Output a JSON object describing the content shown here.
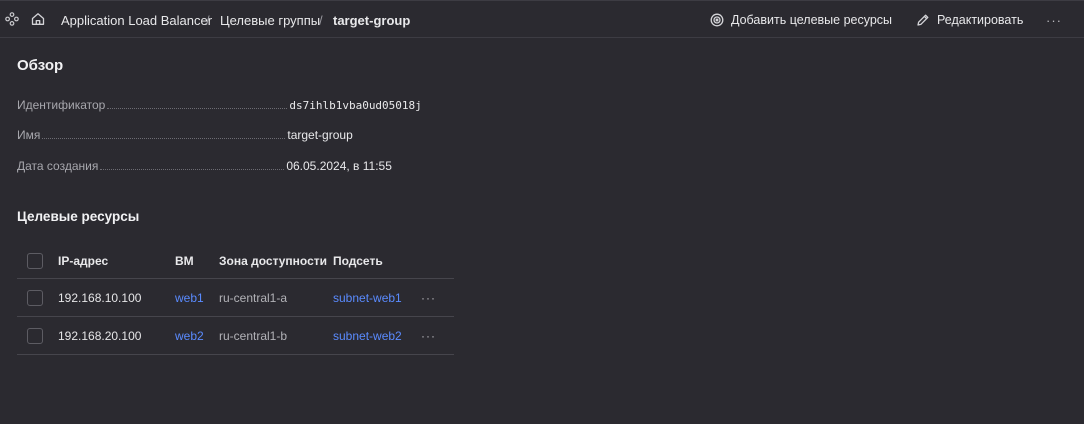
{
  "header": {
    "breadcrumbs": [
      {
        "label": "Application Load Balancer"
      },
      {
        "label": "Целевые группы"
      },
      {
        "label": "target-group"
      }
    ],
    "separator": "/",
    "actions": {
      "add_label": "Добавить целевые ресурсы",
      "edit_label": "Редактировать",
      "more_label": "···"
    }
  },
  "overview": {
    "title": "Обзор",
    "properties": [
      {
        "label": "Идентификатор",
        "value": "ds7ihlb1vba0ud05018j"
      },
      {
        "label": "Имя",
        "value": "target-group"
      },
      {
        "label": "Дата создания",
        "value": "06.05.2024, в 11:55"
      }
    ]
  },
  "resources": {
    "title": "Целевые ресурсы",
    "columns": [
      "IP-адрес",
      "ВМ",
      "Зона доступности",
      "Подсеть"
    ],
    "rows": [
      {
        "ip": "192.168.10.100",
        "vm": "web1",
        "zone": "ru-central1-a",
        "subnet": "subnet-web1",
        "more": "···"
      },
      {
        "ip": "192.168.20.100",
        "vm": "web2",
        "zone": "ru-central1-b",
        "subnet": "subnet-web2",
        "more": "···"
      }
    ]
  },
  "colors": {
    "background": "#2b2a30",
    "link": "#5a8bff",
    "text": "#e6e6e8",
    "muted": "#a7a7ad"
  }
}
